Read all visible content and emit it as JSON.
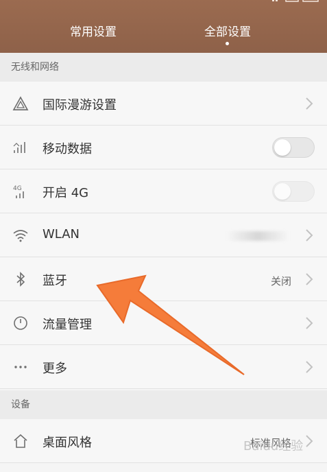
{
  "header": {
    "tabs": [
      {
        "label": "常用设置",
        "active": false
      },
      {
        "label": "全部设置",
        "active": true
      }
    ],
    "background": "#8e6149"
  },
  "sections": [
    {
      "title": "无线和网络"
    },
    {
      "title": "设备"
    }
  ],
  "rows": {
    "roaming": {
      "label": "国际漫游设置",
      "icon": "triangle-icon"
    },
    "mobile_data": {
      "label": "移动数据",
      "icon": "signal-icon",
      "toggle": "off"
    },
    "open4g": {
      "label": "开启 4G",
      "icon": "4g-icon",
      "toggle": "off-disabled"
    },
    "wlan": {
      "label": "WLAN",
      "icon": "wifi-icon",
      "value": ""
    },
    "bluetooth": {
      "label": "蓝牙",
      "icon": "bluetooth-icon",
      "value": "关闭"
    },
    "traffic": {
      "label": "流量管理",
      "icon": "gauge-icon"
    },
    "more": {
      "label": "更多",
      "icon": "ellipsis-icon"
    },
    "desktop_style": {
      "label": "桌面风格",
      "icon": "home-icon",
      "value": "标准风格"
    }
  },
  "annotation": {
    "arrow_color": "#f57c3a"
  },
  "watermark": "Baidu经验"
}
